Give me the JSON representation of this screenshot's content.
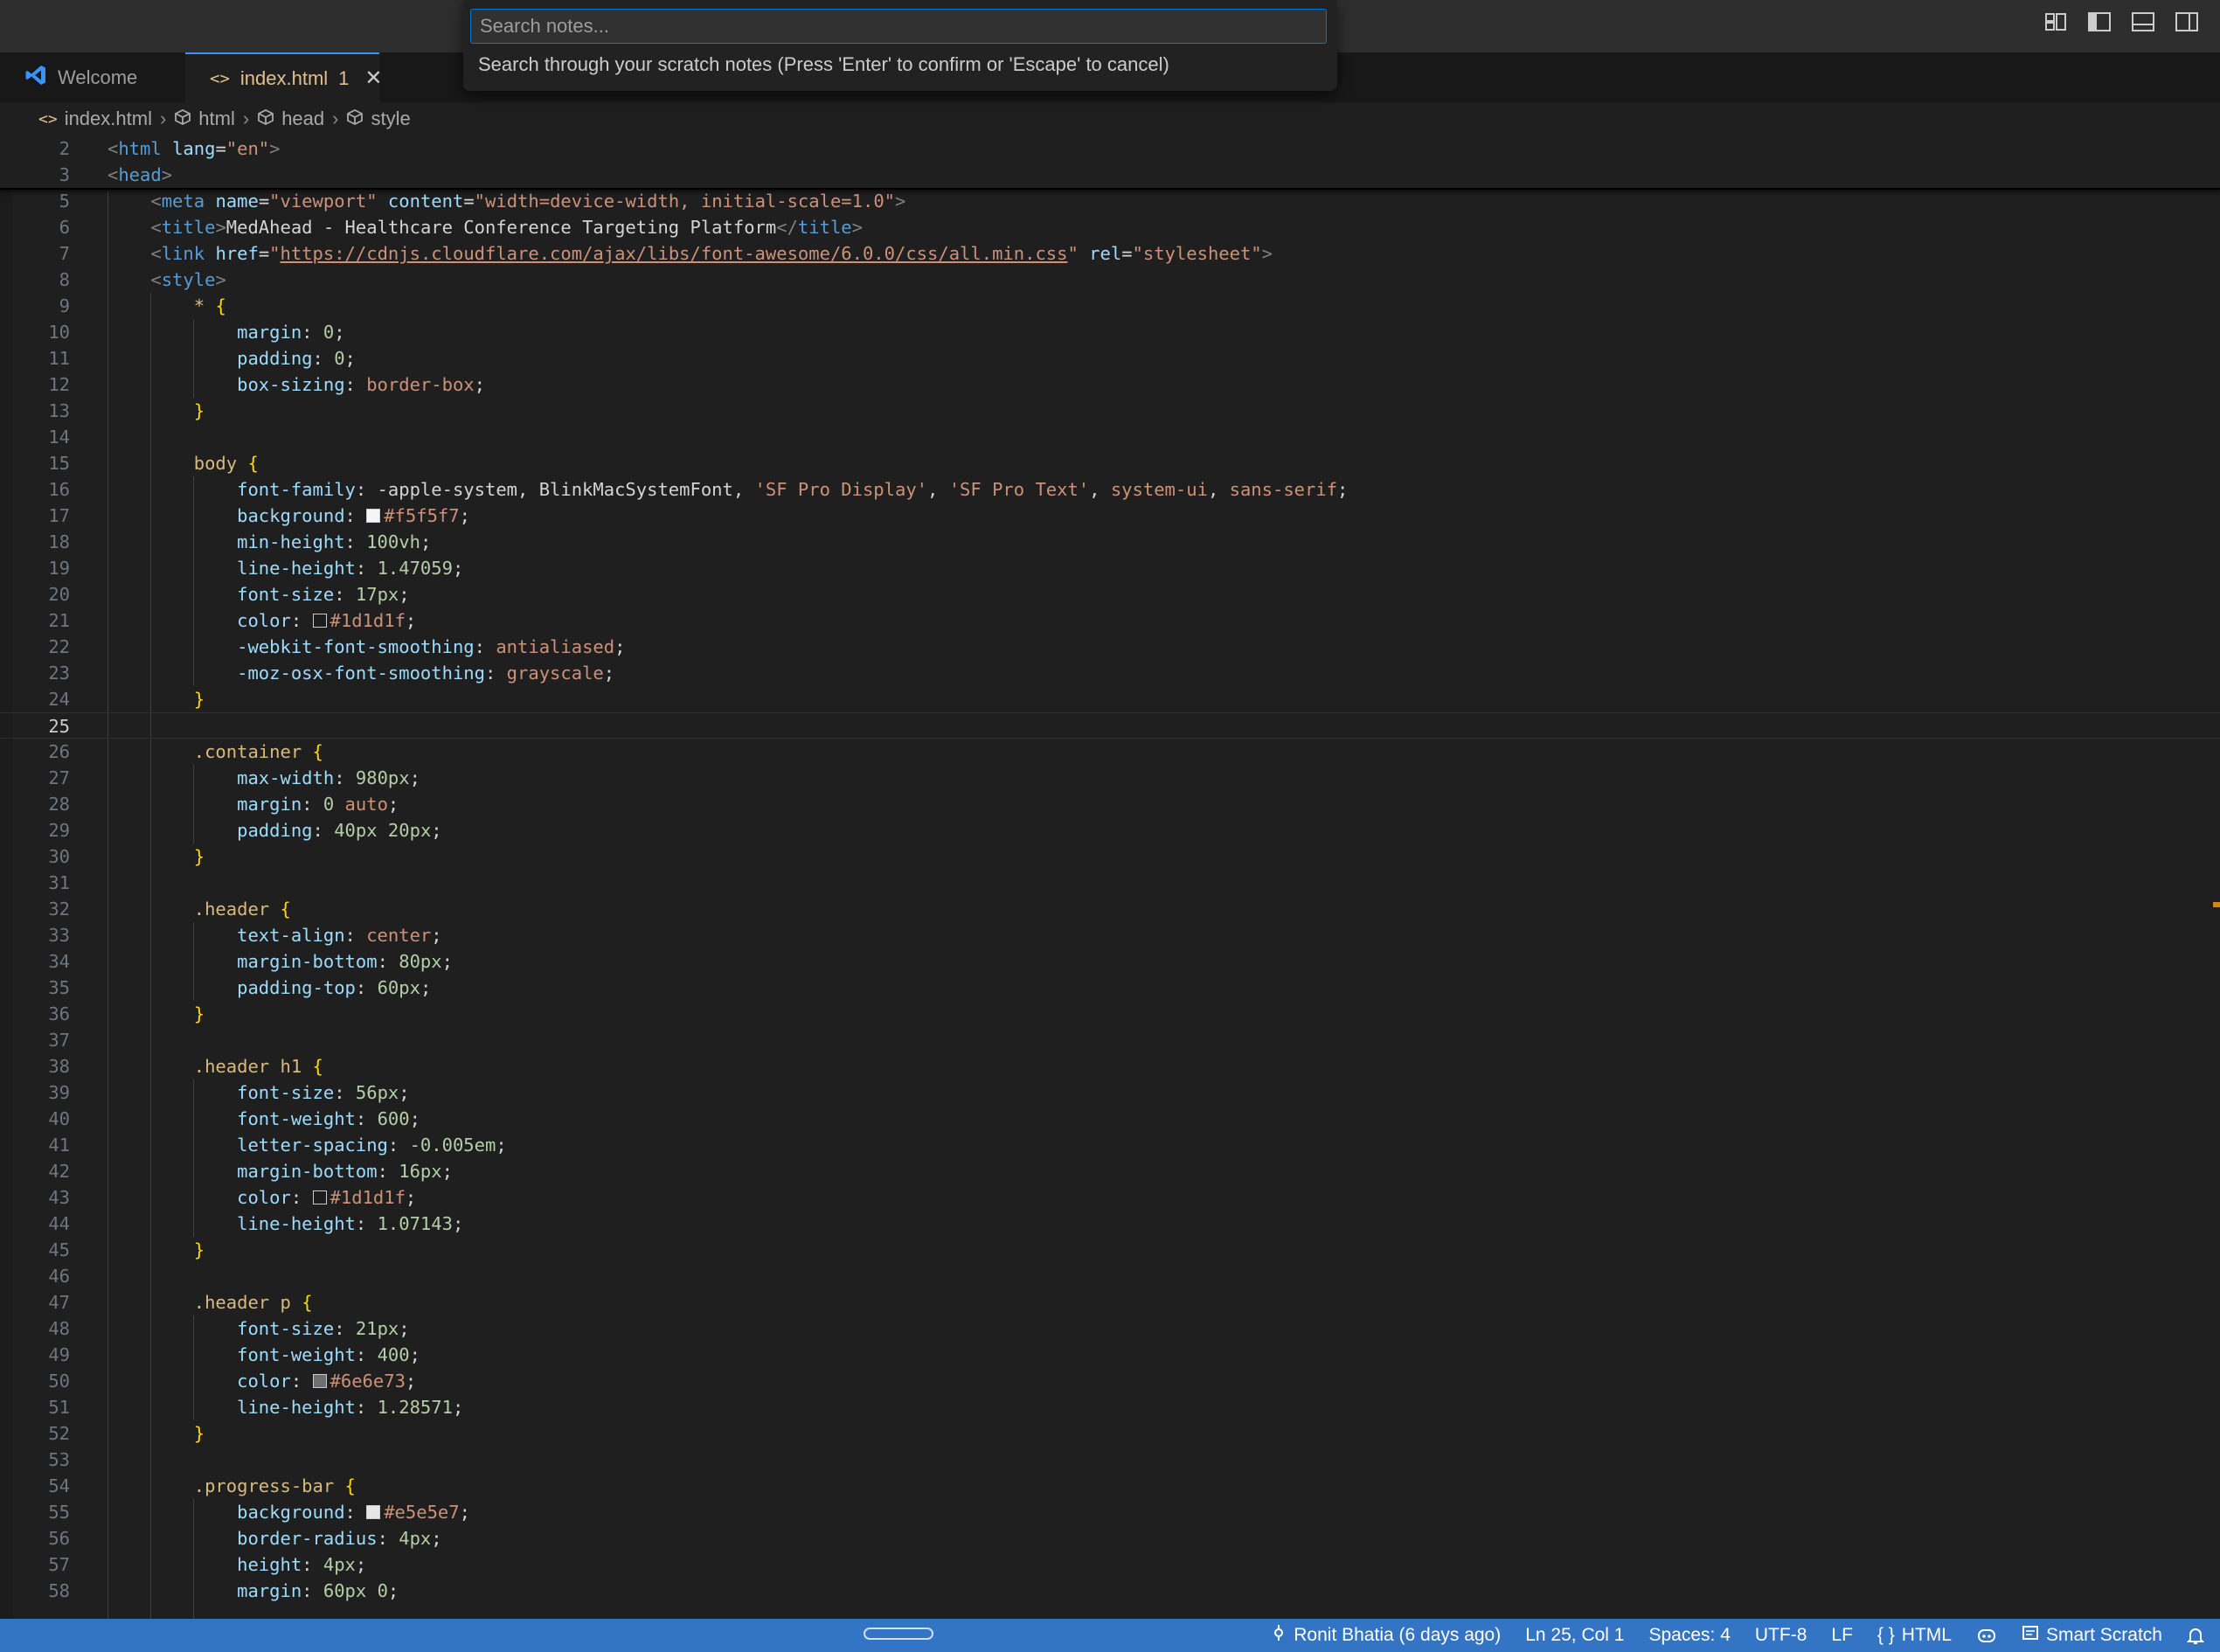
{
  "quick_input": {
    "placeholder": "Search notes...",
    "message": "Search through your scratch notes (Press 'Enter' to confirm or 'Escape' to cancel)"
  },
  "tabs": [
    {
      "label": "Welcome"
    },
    {
      "label": "index.html",
      "badge": "1"
    }
  ],
  "breadcrumb": [
    "index.html",
    "html",
    "head",
    "style"
  ],
  "status": {
    "git": "Ronit Bhatia (6 days ago)",
    "position": "Ln 25, Col 1",
    "spaces": "Spaces: 4",
    "encoding": "UTF-8",
    "eol": "LF",
    "language": "HTML",
    "smart_scratch": "Smart Scratch"
  },
  "colors": {
    "accent": "#0078d4",
    "status_bar": "#3474c4",
    "modified_tab": "#e2c08d"
  },
  "sticky_lines": [
    {
      "n": "2",
      "code": [
        [
          "t-br",
          "<"
        ],
        [
          "t-tag",
          "html"
        ],
        [
          "t-p",
          " "
        ],
        [
          "t-attr",
          "lang"
        ],
        [
          "t-p",
          "="
        ],
        [
          "t-str",
          "\"en\""
        ],
        [
          "t-br",
          ">"
        ]
      ]
    },
    {
      "n": "3",
      "code": [
        [
          "t-br",
          "<"
        ],
        [
          "t-tag",
          "head"
        ],
        [
          "t-br",
          ">"
        ]
      ]
    }
  ],
  "lines": [
    {
      "n": "5",
      "code": [
        [
          "t-p",
          "    "
        ],
        [
          "t-br",
          "<"
        ],
        [
          "t-tag",
          "meta"
        ],
        [
          "t-p",
          " "
        ],
        [
          "t-attr",
          "name"
        ],
        [
          "t-p",
          "="
        ],
        [
          "t-str",
          "\"viewport\""
        ],
        [
          "t-p",
          " "
        ],
        [
          "t-attr",
          "content"
        ],
        [
          "t-p",
          "="
        ],
        [
          "t-str",
          "\"width=device-width, initial-scale=1.0\""
        ],
        [
          "t-br",
          ">"
        ]
      ]
    },
    {
      "n": "6",
      "code": [
        [
          "t-p",
          "    "
        ],
        [
          "t-br",
          "<"
        ],
        [
          "t-tag",
          "title"
        ],
        [
          "t-br",
          ">"
        ],
        [
          "t-text",
          "MedAhead - Healthcare Conference Targeting Platform"
        ],
        [
          "t-br",
          "</"
        ],
        [
          "t-tag",
          "title"
        ],
        [
          "t-br",
          ">"
        ]
      ]
    },
    {
      "n": "7",
      "code": [
        [
          "t-p",
          "    "
        ],
        [
          "t-br",
          "<"
        ],
        [
          "t-tag",
          "link"
        ],
        [
          "t-p",
          " "
        ],
        [
          "t-attr",
          "href"
        ],
        [
          "t-p",
          "="
        ],
        [
          "t-str",
          "\""
        ],
        [
          "t-link",
          "https://cdnjs.cloudflare.com/ajax/libs/font-awesome/6.0.0/css/all.min.css"
        ],
        [
          "t-str",
          "\""
        ],
        [
          "t-p",
          " "
        ],
        [
          "t-attr",
          "rel"
        ],
        [
          "t-p",
          "="
        ],
        [
          "t-str",
          "\"stylesheet\""
        ],
        [
          "t-br",
          ">"
        ]
      ]
    },
    {
      "n": "8",
      "code": [
        [
          "t-p",
          "    "
        ],
        [
          "t-br",
          "<"
        ],
        [
          "t-tag",
          "style"
        ],
        [
          "t-br",
          ">"
        ]
      ]
    },
    {
      "n": "9",
      "code": [
        [
          "t-p",
          "        "
        ],
        [
          "t-sel",
          "*"
        ],
        [
          "t-p",
          " "
        ],
        [
          "t-brace",
          "{"
        ]
      ]
    },
    {
      "n": "10",
      "code": [
        [
          "t-p",
          "            "
        ],
        [
          "t-prop",
          "margin"
        ],
        [
          "t-p",
          ": "
        ],
        [
          "t-num",
          "0"
        ],
        [
          "t-p",
          ";"
        ]
      ]
    },
    {
      "n": "11",
      "code": [
        [
          "t-p",
          "            "
        ],
        [
          "t-prop",
          "padding"
        ],
        [
          "t-p",
          ": "
        ],
        [
          "t-num",
          "0"
        ],
        [
          "t-p",
          ";"
        ]
      ]
    },
    {
      "n": "12",
      "code": [
        [
          "t-p",
          "            "
        ],
        [
          "t-prop",
          "box-sizing"
        ],
        [
          "t-p",
          ": "
        ],
        [
          "t-val",
          "border-box"
        ],
        [
          "t-p",
          ";"
        ]
      ]
    },
    {
      "n": "13",
      "code": [
        [
          "t-p",
          "        "
        ],
        [
          "t-brace",
          "}"
        ]
      ]
    },
    {
      "n": "14",
      "code": []
    },
    {
      "n": "15",
      "code": [
        [
          "t-p",
          "        "
        ],
        [
          "t-sel",
          "body"
        ],
        [
          "t-p",
          " "
        ],
        [
          "t-brace",
          "{"
        ]
      ]
    },
    {
      "n": "16",
      "code": [
        [
          "t-p",
          "            "
        ],
        [
          "t-prop",
          "font-family"
        ],
        [
          "t-p",
          ": -apple-system, BlinkMacSystemFont, "
        ],
        [
          "t-val",
          "'SF Pro Display'"
        ],
        [
          "t-p",
          ", "
        ],
        [
          "t-val",
          "'SF Pro Text'"
        ],
        [
          "t-p",
          ", "
        ],
        [
          "t-val",
          "system-ui"
        ],
        [
          "t-p",
          ", "
        ],
        [
          "t-val",
          "sans-serif"
        ],
        [
          "t-p",
          ";"
        ]
      ]
    },
    {
      "n": "17",
      "code": [
        [
          "t-p",
          "            "
        ],
        [
          "t-prop",
          "background"
        ],
        [
          "t-p",
          ": "
        ],
        [
          "swatch",
          "#f5f5f7"
        ],
        [
          "t-val",
          "#f5f5f7"
        ],
        [
          "t-p",
          ";"
        ]
      ]
    },
    {
      "n": "18",
      "code": [
        [
          "t-p",
          "            "
        ],
        [
          "t-prop",
          "min-height"
        ],
        [
          "t-p",
          ": "
        ],
        [
          "t-num",
          "100vh"
        ],
        [
          "t-p",
          ";"
        ]
      ]
    },
    {
      "n": "19",
      "code": [
        [
          "t-p",
          "            "
        ],
        [
          "t-prop",
          "line-height"
        ],
        [
          "t-p",
          ": "
        ],
        [
          "t-num",
          "1.47059"
        ],
        [
          "t-p",
          ";"
        ]
      ]
    },
    {
      "n": "20",
      "code": [
        [
          "t-p",
          "            "
        ],
        [
          "t-prop",
          "font-size"
        ],
        [
          "t-p",
          ": "
        ],
        [
          "t-num",
          "17px"
        ],
        [
          "t-p",
          ";"
        ]
      ]
    },
    {
      "n": "21",
      "code": [
        [
          "t-p",
          "            "
        ],
        [
          "t-prop",
          "color"
        ],
        [
          "t-p",
          ": "
        ],
        [
          "swatch",
          "#1d1d1f"
        ],
        [
          "t-val",
          "#1d1d1f"
        ],
        [
          "t-p",
          ";"
        ]
      ]
    },
    {
      "n": "22",
      "code": [
        [
          "t-p",
          "            "
        ],
        [
          "t-prop",
          "-webkit-font-smoothing"
        ],
        [
          "t-p",
          ": "
        ],
        [
          "t-val",
          "antialiased"
        ],
        [
          "t-p",
          ";"
        ]
      ]
    },
    {
      "n": "23",
      "code": [
        [
          "t-p",
          "            "
        ],
        [
          "t-prop",
          "-moz-osx-font-smoothing"
        ],
        [
          "t-p",
          ": "
        ],
        [
          "t-val",
          "grayscale"
        ],
        [
          "t-p",
          ";"
        ]
      ]
    },
    {
      "n": "24",
      "code": [
        [
          "t-p",
          "        "
        ],
        [
          "t-brace",
          "}"
        ]
      ]
    },
    {
      "n": "25",
      "code": [],
      "current": true
    },
    {
      "n": "26",
      "code": [
        [
          "t-p",
          "        "
        ],
        [
          "t-sel",
          ".container"
        ],
        [
          "t-p",
          " "
        ],
        [
          "t-brace",
          "{"
        ]
      ]
    },
    {
      "n": "27",
      "code": [
        [
          "t-p",
          "            "
        ],
        [
          "t-prop",
          "max-width"
        ],
        [
          "t-p",
          ": "
        ],
        [
          "t-num",
          "980px"
        ],
        [
          "t-p",
          ";"
        ]
      ]
    },
    {
      "n": "28",
      "code": [
        [
          "t-p",
          "            "
        ],
        [
          "t-prop",
          "margin"
        ],
        [
          "t-p",
          ": "
        ],
        [
          "t-num",
          "0"
        ],
        [
          "t-p",
          " "
        ],
        [
          "t-val",
          "auto"
        ],
        [
          "t-p",
          ";"
        ]
      ]
    },
    {
      "n": "29",
      "code": [
        [
          "t-p",
          "            "
        ],
        [
          "t-prop",
          "padding"
        ],
        [
          "t-p",
          ": "
        ],
        [
          "t-num",
          "40px 20px"
        ],
        [
          "t-p",
          ";"
        ]
      ]
    },
    {
      "n": "30",
      "code": [
        [
          "t-p",
          "        "
        ],
        [
          "t-brace",
          "}"
        ]
      ]
    },
    {
      "n": "31",
      "code": []
    },
    {
      "n": "32",
      "code": [
        [
          "t-p",
          "        "
        ],
        [
          "t-sel",
          ".header"
        ],
        [
          "t-p",
          " "
        ],
        [
          "t-brace",
          "{"
        ]
      ]
    },
    {
      "n": "33",
      "code": [
        [
          "t-p",
          "            "
        ],
        [
          "t-prop",
          "text-align"
        ],
        [
          "t-p",
          ": "
        ],
        [
          "t-val",
          "center"
        ],
        [
          "t-p",
          ";"
        ]
      ]
    },
    {
      "n": "34",
      "code": [
        [
          "t-p",
          "            "
        ],
        [
          "t-prop",
          "margin-bottom"
        ],
        [
          "t-p",
          ": "
        ],
        [
          "t-num",
          "80px"
        ],
        [
          "t-p",
          ";"
        ]
      ]
    },
    {
      "n": "35",
      "code": [
        [
          "t-p",
          "            "
        ],
        [
          "t-prop",
          "padding-top"
        ],
        [
          "t-p",
          ": "
        ],
        [
          "t-num",
          "60px"
        ],
        [
          "t-p",
          ";"
        ]
      ]
    },
    {
      "n": "36",
      "code": [
        [
          "t-p",
          "        "
        ],
        [
          "t-brace",
          "}"
        ]
      ]
    },
    {
      "n": "37",
      "code": []
    },
    {
      "n": "38",
      "code": [
        [
          "t-p",
          "        "
        ],
        [
          "t-sel",
          ".header h1"
        ],
        [
          "t-p",
          " "
        ],
        [
          "t-brace",
          "{"
        ]
      ]
    },
    {
      "n": "39",
      "code": [
        [
          "t-p",
          "            "
        ],
        [
          "t-prop",
          "font-size"
        ],
        [
          "t-p",
          ": "
        ],
        [
          "t-num",
          "56px"
        ],
        [
          "t-p",
          ";"
        ]
      ]
    },
    {
      "n": "40",
      "code": [
        [
          "t-p",
          "            "
        ],
        [
          "t-prop",
          "font-weight"
        ],
        [
          "t-p",
          ": "
        ],
        [
          "t-num",
          "600"
        ],
        [
          "t-p",
          ";"
        ]
      ]
    },
    {
      "n": "41",
      "code": [
        [
          "t-p",
          "            "
        ],
        [
          "t-prop",
          "letter-spacing"
        ],
        [
          "t-p",
          ": "
        ],
        [
          "t-num",
          "-0.005em"
        ],
        [
          "t-p",
          ";"
        ]
      ]
    },
    {
      "n": "42",
      "code": [
        [
          "t-p",
          "            "
        ],
        [
          "t-prop",
          "margin-bottom"
        ],
        [
          "t-p",
          ": "
        ],
        [
          "t-num",
          "16px"
        ],
        [
          "t-p",
          ";"
        ]
      ]
    },
    {
      "n": "43",
      "code": [
        [
          "t-p",
          "            "
        ],
        [
          "t-prop",
          "color"
        ],
        [
          "t-p",
          ": "
        ],
        [
          "swatch",
          "#1d1d1f"
        ],
        [
          "t-val",
          "#1d1d1f"
        ],
        [
          "t-p",
          ";"
        ]
      ]
    },
    {
      "n": "44",
      "code": [
        [
          "t-p",
          "            "
        ],
        [
          "t-prop",
          "line-height"
        ],
        [
          "t-p",
          ": "
        ],
        [
          "t-num",
          "1.07143"
        ],
        [
          "t-p",
          ";"
        ]
      ]
    },
    {
      "n": "45",
      "code": [
        [
          "t-p",
          "        "
        ],
        [
          "t-brace",
          "}"
        ]
      ]
    },
    {
      "n": "46",
      "code": []
    },
    {
      "n": "47",
      "code": [
        [
          "t-p",
          "        "
        ],
        [
          "t-sel",
          ".header p"
        ],
        [
          "t-p",
          " "
        ],
        [
          "t-brace",
          "{"
        ]
      ]
    },
    {
      "n": "48",
      "code": [
        [
          "t-p",
          "            "
        ],
        [
          "t-prop",
          "font-size"
        ],
        [
          "t-p",
          ": "
        ],
        [
          "t-num",
          "21px"
        ],
        [
          "t-p",
          ";"
        ]
      ]
    },
    {
      "n": "49",
      "code": [
        [
          "t-p",
          "            "
        ],
        [
          "t-prop",
          "font-weight"
        ],
        [
          "t-p",
          ": "
        ],
        [
          "t-num",
          "400"
        ],
        [
          "t-p",
          ";"
        ]
      ]
    },
    {
      "n": "50",
      "code": [
        [
          "t-p",
          "            "
        ],
        [
          "t-prop",
          "color"
        ],
        [
          "t-p",
          ": "
        ],
        [
          "swatch",
          "#6e6e73"
        ],
        [
          "t-val",
          "#6e6e73"
        ],
        [
          "t-p",
          ";"
        ]
      ]
    },
    {
      "n": "51",
      "code": [
        [
          "t-p",
          "            "
        ],
        [
          "t-prop",
          "line-height"
        ],
        [
          "t-p",
          ": "
        ],
        [
          "t-num",
          "1.28571"
        ],
        [
          "t-p",
          ";"
        ]
      ]
    },
    {
      "n": "52",
      "code": [
        [
          "t-p",
          "        "
        ],
        [
          "t-brace",
          "}"
        ]
      ]
    },
    {
      "n": "53",
      "code": []
    },
    {
      "n": "54",
      "code": [
        [
          "t-p",
          "        "
        ],
        [
          "t-sel",
          ".progress-bar"
        ],
        [
          "t-p",
          " "
        ],
        [
          "t-brace",
          "{"
        ]
      ]
    },
    {
      "n": "55",
      "code": [
        [
          "t-p",
          "            "
        ],
        [
          "t-prop",
          "background"
        ],
        [
          "t-p",
          ": "
        ],
        [
          "swatch",
          "#e5e5e7"
        ],
        [
          "t-val",
          "#e5e5e7"
        ],
        [
          "t-p",
          ";"
        ]
      ]
    },
    {
      "n": "56",
      "code": [
        [
          "t-p",
          "            "
        ],
        [
          "t-prop",
          "border-radius"
        ],
        [
          "t-p",
          ": "
        ],
        [
          "t-num",
          "4px"
        ],
        [
          "t-p",
          ";"
        ]
      ]
    },
    {
      "n": "57",
      "code": [
        [
          "t-p",
          "            "
        ],
        [
          "t-prop",
          "height"
        ],
        [
          "t-p",
          ": "
        ],
        [
          "t-num",
          "4px"
        ],
        [
          "t-p",
          ";"
        ]
      ]
    },
    {
      "n": "58",
      "code": [
        [
          "t-p",
          "            "
        ],
        [
          "t-prop",
          "margin"
        ],
        [
          "t-p",
          ": "
        ],
        [
          "t-num",
          "60px 0"
        ],
        [
          "t-p",
          ";"
        ]
      ]
    }
  ]
}
